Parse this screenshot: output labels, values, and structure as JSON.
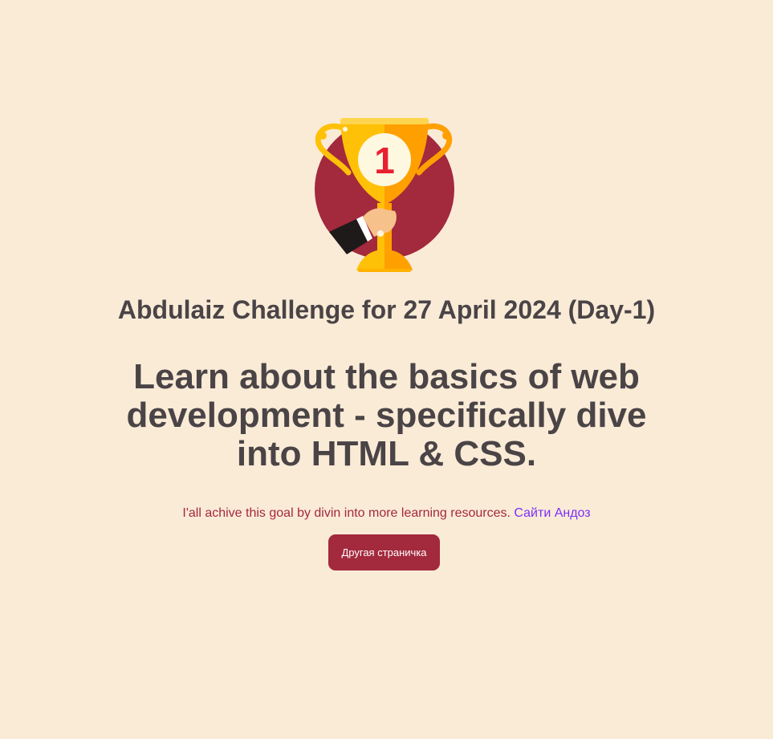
{
  "hero": {
    "image_icon": "trophy-icon",
    "badge_number": "1"
  },
  "title": "Abdulaiz Challenge for 27 April 2024 (Day-1)",
  "headline": "Learn about the basics of web development - specifically dive into HTML & CSS.",
  "goal": {
    "text": "I'all achive this goal by divin into more learning resources.",
    "link_label": "Сайти Андоз"
  },
  "cta": {
    "label": "Другая страничка"
  },
  "colors": {
    "background": "#FAEBD7",
    "text": "#4A4446",
    "accent": "#A3293D",
    "link": "#7B2FF7",
    "gold": "#FFC107"
  }
}
